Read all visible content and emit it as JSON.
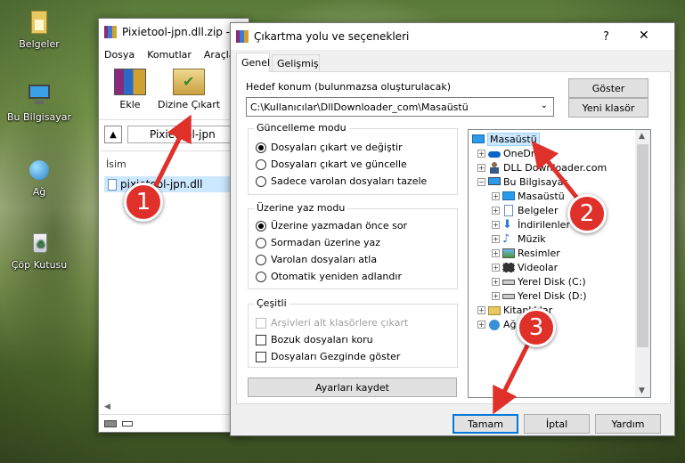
{
  "desktop": {
    "icons": [
      {
        "label": "Belgeler"
      },
      {
        "label": "Bu Bilgisayar"
      },
      {
        "label": "Ağ"
      },
      {
        "label": "Çöp Kutusu"
      }
    ]
  },
  "winrar": {
    "title": "Pixietool-jpn.dll.zip -",
    "menu": [
      "Dosya",
      "Komutlar",
      "Araçla"
    ],
    "toolbar": {
      "add": "Ekle",
      "extract": "Dizine Çıkart"
    },
    "path": "Pixietool-jpn",
    "column_name": "İsim",
    "file": "pixietool-jpn.dll"
  },
  "dialog": {
    "title": "Çıkartma yolu ve seçenekleri",
    "help": "?",
    "close": "✕",
    "tabs": [
      "Genel",
      "Gelişmiş"
    ],
    "dest_label": "Hedef konum (bulunmazsa oluşturulacak)",
    "dest_value": "C:\\Kullanıcılar\\DllDownloader_com\\Masaüstü",
    "show_btn": "Göster",
    "new_folder_btn": "Yeni klasör",
    "update_mode": {
      "title": "Güncelleme modu",
      "options": [
        "Dosyaları çıkart ve değiştir",
        "Dosyaları çıkart ve güncelle",
        "Sadece varolan dosyaları tazele"
      ],
      "selected": 0
    },
    "overwrite_mode": {
      "title": "Üzerine yaz modu",
      "options": [
        "Üzerine yazmadan önce sor",
        "Sormadan üzerine yaz",
        "Varolan dosyaları atla",
        "Otomatik yeniden adlandır"
      ],
      "selected": 0
    },
    "misc": {
      "title": "Çeşitli",
      "options": [
        "Arşivleri alt klasörlere çıkart",
        "Bozuk dosyaları koru",
        "Dosyaları Gezginde göster"
      ]
    },
    "save_btn": "Ayarları kaydet",
    "tree": [
      {
        "label": "Masaüstü",
        "icon": "desktop-icon"
      },
      {
        "label": "OneDrive",
        "icon": "cloud-icon"
      },
      {
        "label": "DLL Downloader.com",
        "icon": "user-icon"
      },
      {
        "label": "Bu Bilgisayar",
        "icon": "computer-icon"
      },
      {
        "label": "Masaüstü",
        "icon": "desktop-icon"
      },
      {
        "label": "Belgeler",
        "icon": "documents-icon"
      },
      {
        "label": "İndirilenler",
        "icon": "download-icon"
      },
      {
        "label": "Müzik",
        "icon": "music-icon"
      },
      {
        "label": "Resimler",
        "icon": "pictures-icon"
      },
      {
        "label": "Videolar",
        "icon": "video-icon"
      },
      {
        "label": "Yerel Disk (C:)",
        "icon": "drive-icon"
      },
      {
        "label": "Yerel Disk (D:)",
        "icon": "drive-icon"
      },
      {
        "label": "Kitaplıklar",
        "icon": "libraries-icon"
      },
      {
        "label": "Ağ",
        "icon": "network-icon"
      }
    ],
    "ok_btn": "Tamam",
    "cancel_btn": "İptal",
    "help_btn": "Yardım"
  },
  "badges": [
    "1",
    "2",
    "3"
  ],
  "colors": {
    "badge": "#e0302a",
    "selection": "#cce8ff",
    "accent": "#0078d7"
  }
}
